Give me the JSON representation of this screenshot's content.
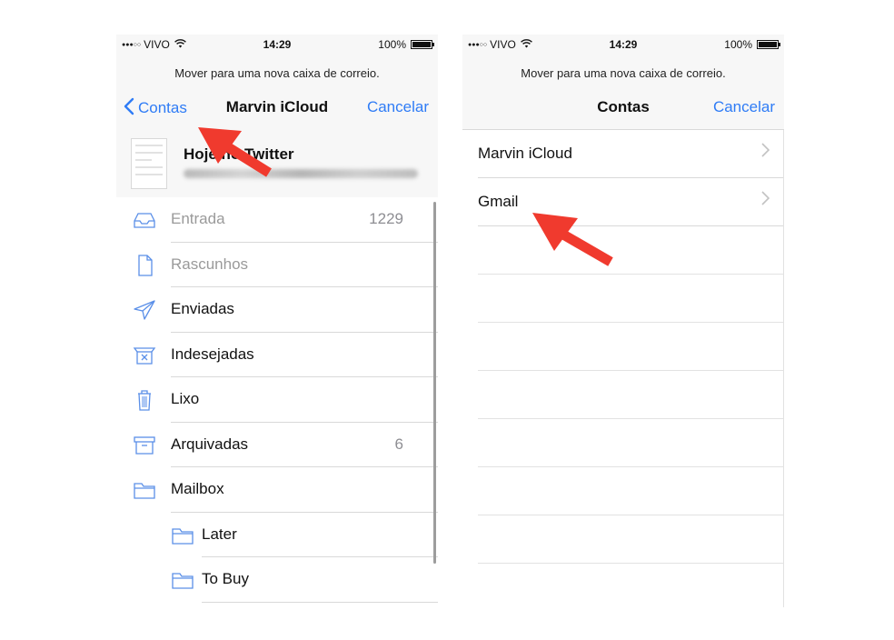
{
  "status": {
    "carrier": "VIVO",
    "time": "14:29",
    "battery": "100%"
  },
  "hint": "Mover para uma nova caixa de correio.",
  "left_screen": {
    "back_label": "Contas",
    "title": "Marvin iCloud",
    "cancel_label": "Cancelar",
    "message_subject": "Hoje no Twitter",
    "folders": [
      {
        "label": "Entrada",
        "count": "1229",
        "icon": "inbox-icon"
      },
      {
        "label": "Rascunhos",
        "count": "",
        "icon": "draft-document-icon"
      },
      {
        "label": "Enviadas",
        "count": "",
        "icon": "paper-plane-icon"
      },
      {
        "label": "Indesejadas",
        "count": "",
        "icon": "junk-box-icon"
      },
      {
        "label": "Lixo",
        "count": "",
        "icon": "trash-icon"
      },
      {
        "label": "Arquivadas",
        "count": "6",
        "icon": "archive-box-icon"
      },
      {
        "label": "Mailbox",
        "count": "",
        "icon": "folder-icon"
      },
      {
        "label": "Later",
        "count": "",
        "icon": "folder-icon"
      },
      {
        "label": "To Buy",
        "count": "",
        "icon": "folder-icon"
      }
    ]
  },
  "right_screen": {
    "title": "Contas",
    "cancel_label": "Cancelar",
    "accounts": [
      {
        "label": "Marvin iCloud"
      },
      {
        "label": "Gmail"
      }
    ]
  },
  "colors": {
    "accent": "#2f7cf6",
    "annotation_arrow": "#f03a2e"
  }
}
